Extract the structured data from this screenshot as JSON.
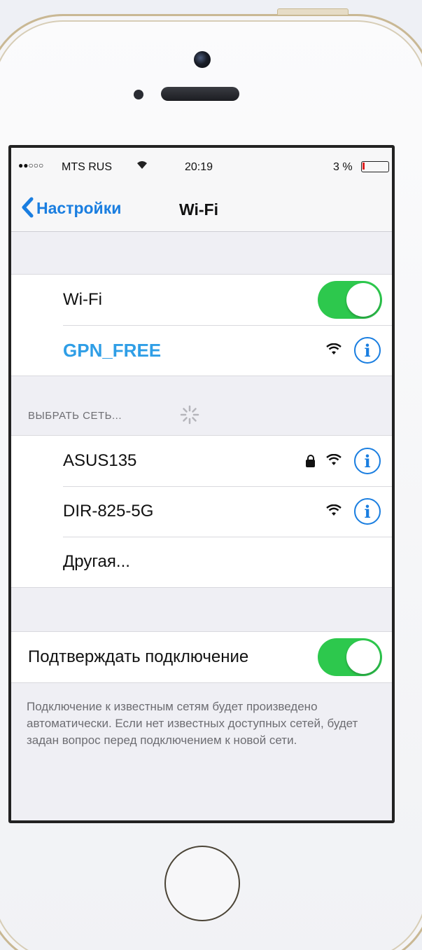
{
  "status_bar": {
    "signal": "●●○○○",
    "carrier": "MTS RUS",
    "wifi_icon": "wifi-icon",
    "time": "20:19",
    "battery_percent": "3 %",
    "battery_level": 0.03,
    "battery_color": "#e02020"
  },
  "nav": {
    "back_label": "Настройки",
    "back_icon": "chevron-left-icon",
    "title": "Wi-Fi"
  },
  "wifi_group": {
    "wifi_label": "Wi-Fi",
    "wifi_enabled": true,
    "connected_network": "GPN_FREE",
    "connected_network_color": "#2f9ee6"
  },
  "choose_network": {
    "header": "ВЫБРАТЬ СЕТЬ...",
    "networks": [
      {
        "name": "ASUS135",
        "secured": true
      },
      {
        "name": "DIR-825-5G",
        "secured": false
      }
    ],
    "other_label": "Другая..."
  },
  "ask_to_join": {
    "label": "Подтверждать подключение",
    "enabled": true,
    "description": "Подключение к известным сетям будет произведено автоматически. Если нет известных доступных сетей, будет задан вопрос перед подключением к новой сети."
  },
  "colors": {
    "accent": "#1a7ee0",
    "toggle_on": "#2dc84d",
    "background": "#efeff4"
  }
}
